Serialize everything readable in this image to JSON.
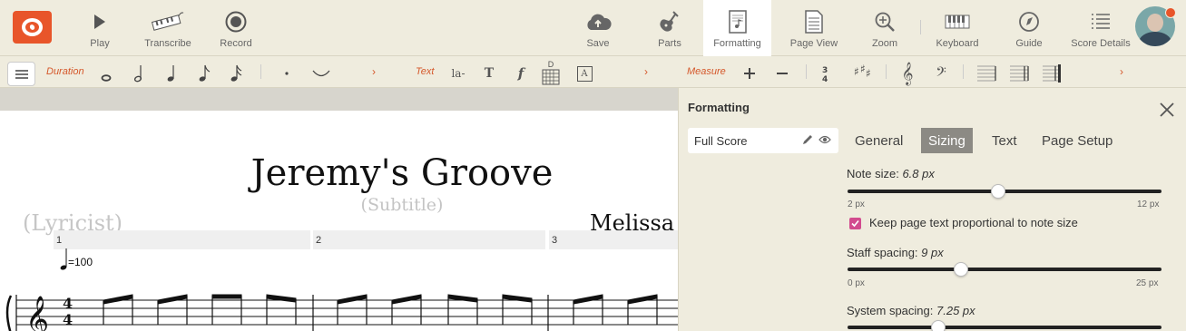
{
  "toolbar": {
    "play": "Play",
    "transcribe": "Transcribe",
    "record": "Record",
    "save": "Save",
    "parts": "Parts",
    "formatting": "Formatting",
    "page_view": "Page View",
    "zoom": "Zoom",
    "keyboard": "Keyboard",
    "guide": "Guide",
    "score_details": "Score Details"
  },
  "palette": {
    "duration_label": "Duration",
    "text_label": "Text",
    "measure_label": "Measure",
    "lyric_tool": "la-",
    "text_tool": "T",
    "dynamics_tool": "f",
    "chord_diagram_tool": "D",
    "rehearsal_tool": "A",
    "chevron": "›"
  },
  "score": {
    "title": "Jeremy's Groove",
    "subtitle": "(Subtitle)",
    "lyricist": "(Lyricist)",
    "composer": "Melissa",
    "tempo": "=100",
    "time_signature": [
      "4",
      "4"
    ],
    "measures": [
      "1",
      "2",
      "3"
    ]
  },
  "panel": {
    "title": "Formatting",
    "scope": "Full Score",
    "tabs": [
      "General",
      "Sizing",
      "Text",
      "Page Setup"
    ],
    "active_tab": "Sizing",
    "note_size": {
      "label": "Note size:",
      "value": "6.8 px",
      "min": "2 px",
      "max": "12 px",
      "fraction": 0.48
    },
    "keep_proportional": {
      "label": "Keep page text proportional to note size",
      "checked": true
    },
    "staff_spacing": {
      "label": "Staff spacing:",
      "value": "9 px",
      "min": "0 px",
      "max": "25 px",
      "fraction": 0.36
    },
    "system_spacing": {
      "label": "System spacing:",
      "value": "7.25 px",
      "fraction": 0.29
    }
  },
  "colors": {
    "accent": "#d5582b",
    "background": "#efecde",
    "checkbox": "#d24b8e",
    "active_tab": "#8c8a84"
  }
}
